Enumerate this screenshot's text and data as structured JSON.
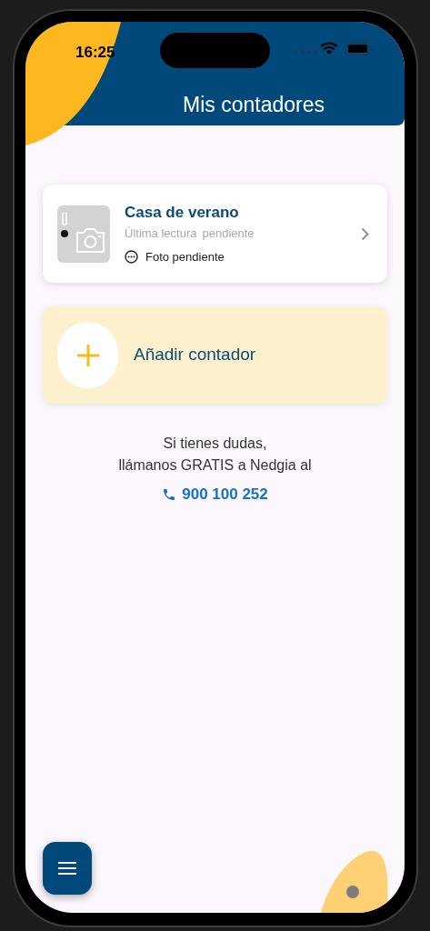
{
  "status_bar": {
    "time": "16:25"
  },
  "header": {
    "title": "Mis contadores"
  },
  "meters": [
    {
      "name": "Casa de verano",
      "last_reading_label": "Última lectura",
      "last_reading_value": "pendiente",
      "photo_status": "Foto pendiente",
      "photo_pending": true
    }
  ],
  "add_meter": {
    "label": "Añadir contador"
  },
  "help": {
    "lines": [
      "Si tienes dudas,",
      "llámanos GRATIS a Nedgia al"
    ],
    "phone": "900 100 252"
  }
}
